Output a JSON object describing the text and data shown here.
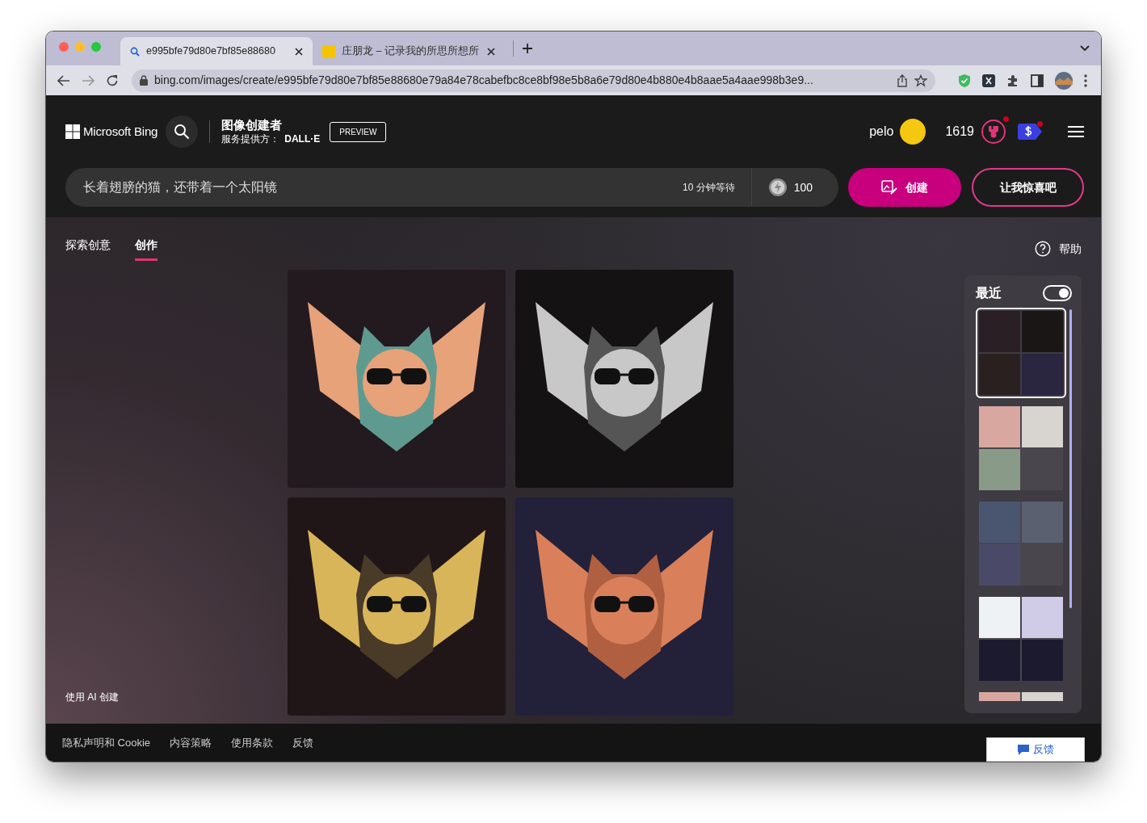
{
  "browser": {
    "tabs": [
      {
        "title": "e995bfe79d80e7bf85e88680",
        "selected": true
      },
      {
        "title": "庄朋龙 – 记录我的所思所想所",
        "selected": false
      }
    ],
    "url": "bing.com/images/create/e995bfe79d80e7bf85e88680e79a84e78cabefbc8ce8bf98e5b8a6e79d80e4b880e4b8aae5a4aae998b3e9..."
  },
  "header": {
    "brand": "Microsoft Bing",
    "title": "图像创建者",
    "subtitle_label": "服务提供方：",
    "subtitle_provider": "DALL·E",
    "badge": "PREVIEW",
    "user": "pelo",
    "points": "1619",
    "rewards_notification": true,
    "offers_notification": true
  },
  "prompt": {
    "value": "长着翅膀的猫，还带着一个太阳镜",
    "wait": "10 分钟等待",
    "boosts": "100"
  },
  "buttons": {
    "create": "创建",
    "surprise": "让我惊喜吧"
  },
  "nav": {
    "tabs": [
      {
        "label": "探索创意",
        "selected": false
      },
      {
        "label": "创作",
        "selected": true
      }
    ],
    "help": "帮助"
  },
  "results": [
    {
      "kind": "peach"
    },
    {
      "kind": "silver"
    },
    {
      "kind": "gold"
    },
    {
      "kind": "coral"
    }
  ],
  "side_note": "使用 AI 创建",
  "recent": {
    "title": "最近",
    "toggle_on": true,
    "groups": [
      {
        "selected": true,
        "images": [
          {
            "kind": "cat-art"
          },
          {
            "kind": "cat-art"
          },
          {
            "kind": "cat-art"
          },
          {
            "kind": "cat-art"
          }
        ]
      },
      {
        "selected": false,
        "images": [
          {
            "kind": "portrait"
          },
          {
            "kind": "portrait"
          },
          {
            "kind": "portrait"
          }
        ]
      },
      {
        "selected": false,
        "images": [
          {
            "kind": "landscape"
          },
          {
            "kind": "landscape"
          },
          {
            "kind": "landscape"
          }
        ]
      },
      {
        "selected": false,
        "images": [
          {
            "kind": "app-icon"
          },
          {
            "kind": "app-icon"
          },
          {
            "kind": "app-icon"
          },
          {
            "kind": "app-icon"
          }
        ]
      },
      {
        "selected": false,
        "images": [
          {
            "kind": "portrait"
          },
          {
            "kind": "portrait"
          }
        ]
      }
    ]
  },
  "footer": {
    "links": [
      "隐私声明和 Cookie",
      "内容策略",
      "使用条款",
      "反馈"
    ],
    "feedback": "反馈"
  }
}
